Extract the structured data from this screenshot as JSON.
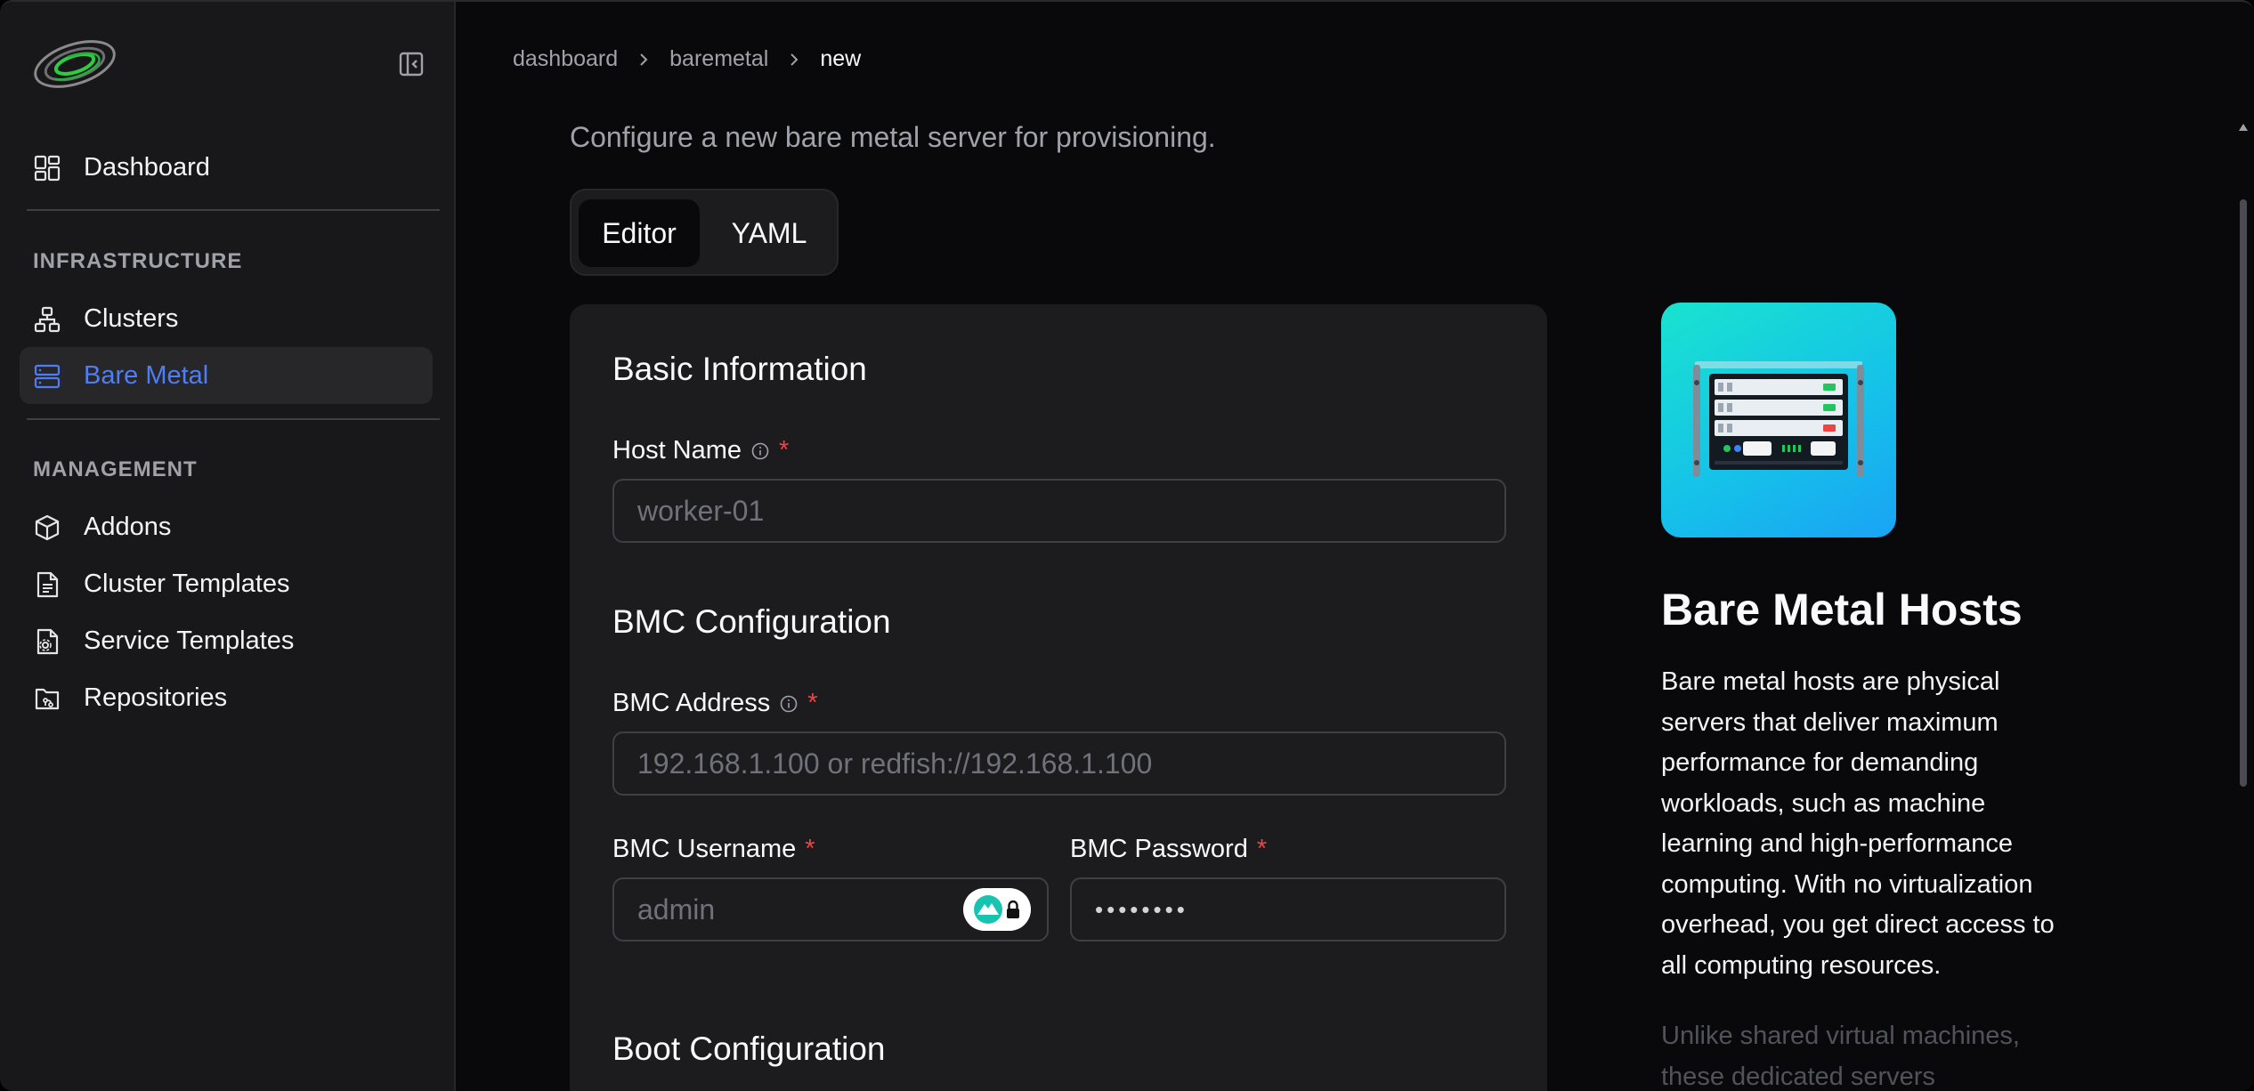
{
  "sidebar": {
    "logo": "app-logo",
    "collapse_icon": "sidebar-collapse-icon",
    "dashboard": {
      "label": "Dashboard",
      "icon": "dashboard-icon"
    },
    "sections": [
      {
        "title": "INFRASTRUCTURE",
        "items": [
          {
            "label": "Clusters",
            "icon": "clusters-icon"
          },
          {
            "label": "Bare Metal",
            "icon": "server-icon",
            "active": true
          }
        ]
      },
      {
        "title": "MANAGEMENT",
        "items": [
          {
            "label": "Addons",
            "icon": "package-icon"
          },
          {
            "label": "Cluster Templates",
            "icon": "file-text-icon"
          },
          {
            "label": "Service Templates",
            "icon": "file-gear-icon"
          },
          {
            "label": "Repositories",
            "icon": "folder-git-icon"
          }
        ]
      }
    ]
  },
  "breadcrumb": [
    "dashboard",
    "baremetal",
    "new"
  ],
  "subtitle": "Configure a new bare metal server for provisioning.",
  "tabs": [
    {
      "label": "Editor",
      "active": true
    },
    {
      "label": "YAML",
      "active": false
    }
  ],
  "form": {
    "basic": {
      "title": "Basic Information",
      "host_name": {
        "label": "Host Name",
        "placeholder": "worker-01"
      }
    },
    "bmc": {
      "title": "BMC Configuration",
      "address": {
        "label": "BMC Address",
        "placeholder": "192.168.1.100 or redfish://192.168.1.100"
      },
      "username": {
        "label": "BMC Username",
        "placeholder": "admin"
      },
      "password": {
        "label": "BMC Password",
        "value": "••••••••"
      }
    },
    "boot": {
      "title": "Boot Configuration"
    },
    "required_mark": "*"
  },
  "panel": {
    "title": "Bare Metal Hosts",
    "text": "Bare metal hosts are physical servers that deliver maximum performance for demanding workloads, such as machine learning and high-performance computing. With no virtualization overhead, you get direct access to all computing resources.",
    "text_faded": "Unlike shared virtual machines, these dedicated servers"
  },
  "colors": {
    "accent": "#4f7df5",
    "required": "#ef4444",
    "background": "#09090b",
    "card": "#1c1c1f"
  }
}
